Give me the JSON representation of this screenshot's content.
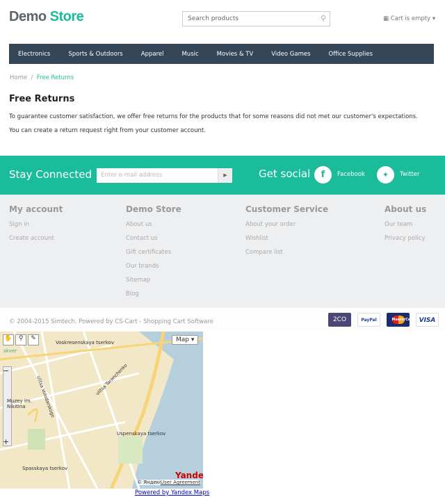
{
  "header": {
    "logo_part1": "Demo",
    "logo_part2": "Store",
    "search_placeholder": "Search products",
    "cart": "Cart is empty"
  },
  "nav": [
    "Electronics",
    "Sports & Outdoors",
    "Apparel",
    "Music",
    "Movies & TV",
    "Video Games",
    "Office Supplies"
  ],
  "breadcrumb": {
    "home": "Home",
    "sep": "/",
    "current": "Free Returns"
  },
  "page": {
    "title": "Free Returns",
    "p1": "To guarantee customer satisfaction, we offer free returns for the products that for some reasons did not met our customer's expectations.",
    "p2": "You can create a return request right from your customer account."
  },
  "newsletter": {
    "title": "Stay Connected",
    "placeholder": "Enter e-mail address",
    "social_title": "Get social",
    "facebook": "Facebook",
    "twitter": "Twitter"
  },
  "footer": {
    "cols": [
      {
        "title": "My account",
        "links": [
          "Sign in",
          "Create account"
        ]
      },
      {
        "title": "Demo Store",
        "links": [
          "About us",
          "Contact us",
          "Gift certificates",
          "Our brands",
          "Sitemap",
          "Blog"
        ]
      },
      {
        "title": "Customer Service",
        "links": [
          "About your order",
          "Wishlist",
          "Compare list"
        ]
      },
      {
        "title": "About us",
        "links": [
          "Our team",
          "Privacy policy"
        ]
      }
    ],
    "copyright": "© 2004-2015 Simtech.  Powered by CS-Cart - Shopping Cart Software",
    "payments": [
      "2CO",
      "PayPal",
      "MasterCard",
      "VISA"
    ]
  },
  "map": {
    "type_button": "Map",
    "labels": [
      "Voskresenskaya tserkov",
      "Muzey im. Nikitina",
      "Uspenskaya tserkov",
      "Spasskaya tserkov",
      "ulitsa Volodarskogo",
      "ulitsa Taranchenko",
      "skver"
    ],
    "copyright": "© Яндекс",
    "agreement": "User Agreement",
    "brand": "Yandex",
    "powered": "Powered by Yandex Maps"
  },
  "colors": {
    "accent": "#1bbc9b",
    "nav": "#344558"
  }
}
